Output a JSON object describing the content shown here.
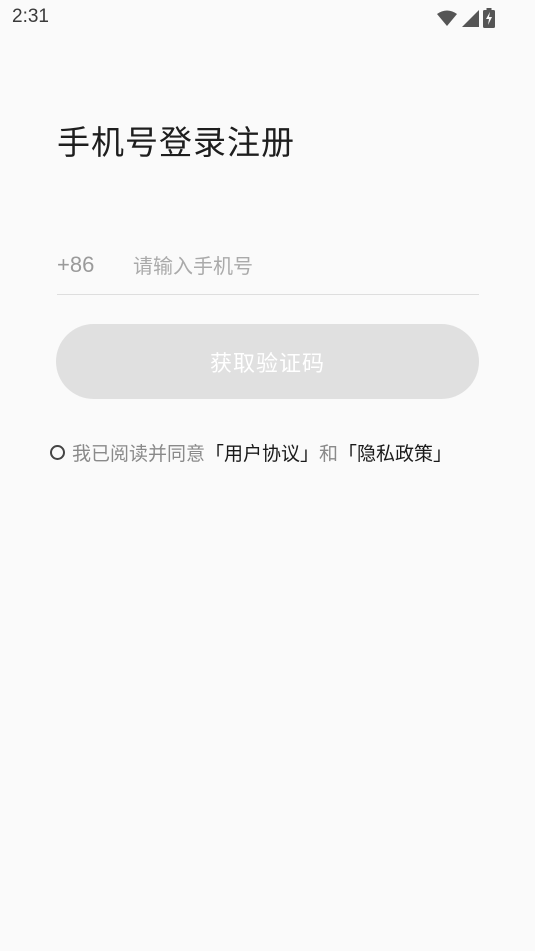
{
  "status_bar": {
    "time": "2:31",
    "icons": [
      "wifi-icon",
      "cellular-signal-icon",
      "battery-charging-icon"
    ]
  },
  "page": {
    "title": "手机号登录注册"
  },
  "phone": {
    "country_code": "+86",
    "placeholder": "请输入手机号",
    "value": ""
  },
  "actions": {
    "get_code_label": "获取验证码",
    "button_color": "#e0e0e0",
    "button_enabled": false
  },
  "agreement": {
    "checked": false,
    "prefix": "我已阅读并同意",
    "user_agreement": "「用户协议」",
    "conjunction": "和",
    "privacy_policy": "「隐私政策」"
  }
}
